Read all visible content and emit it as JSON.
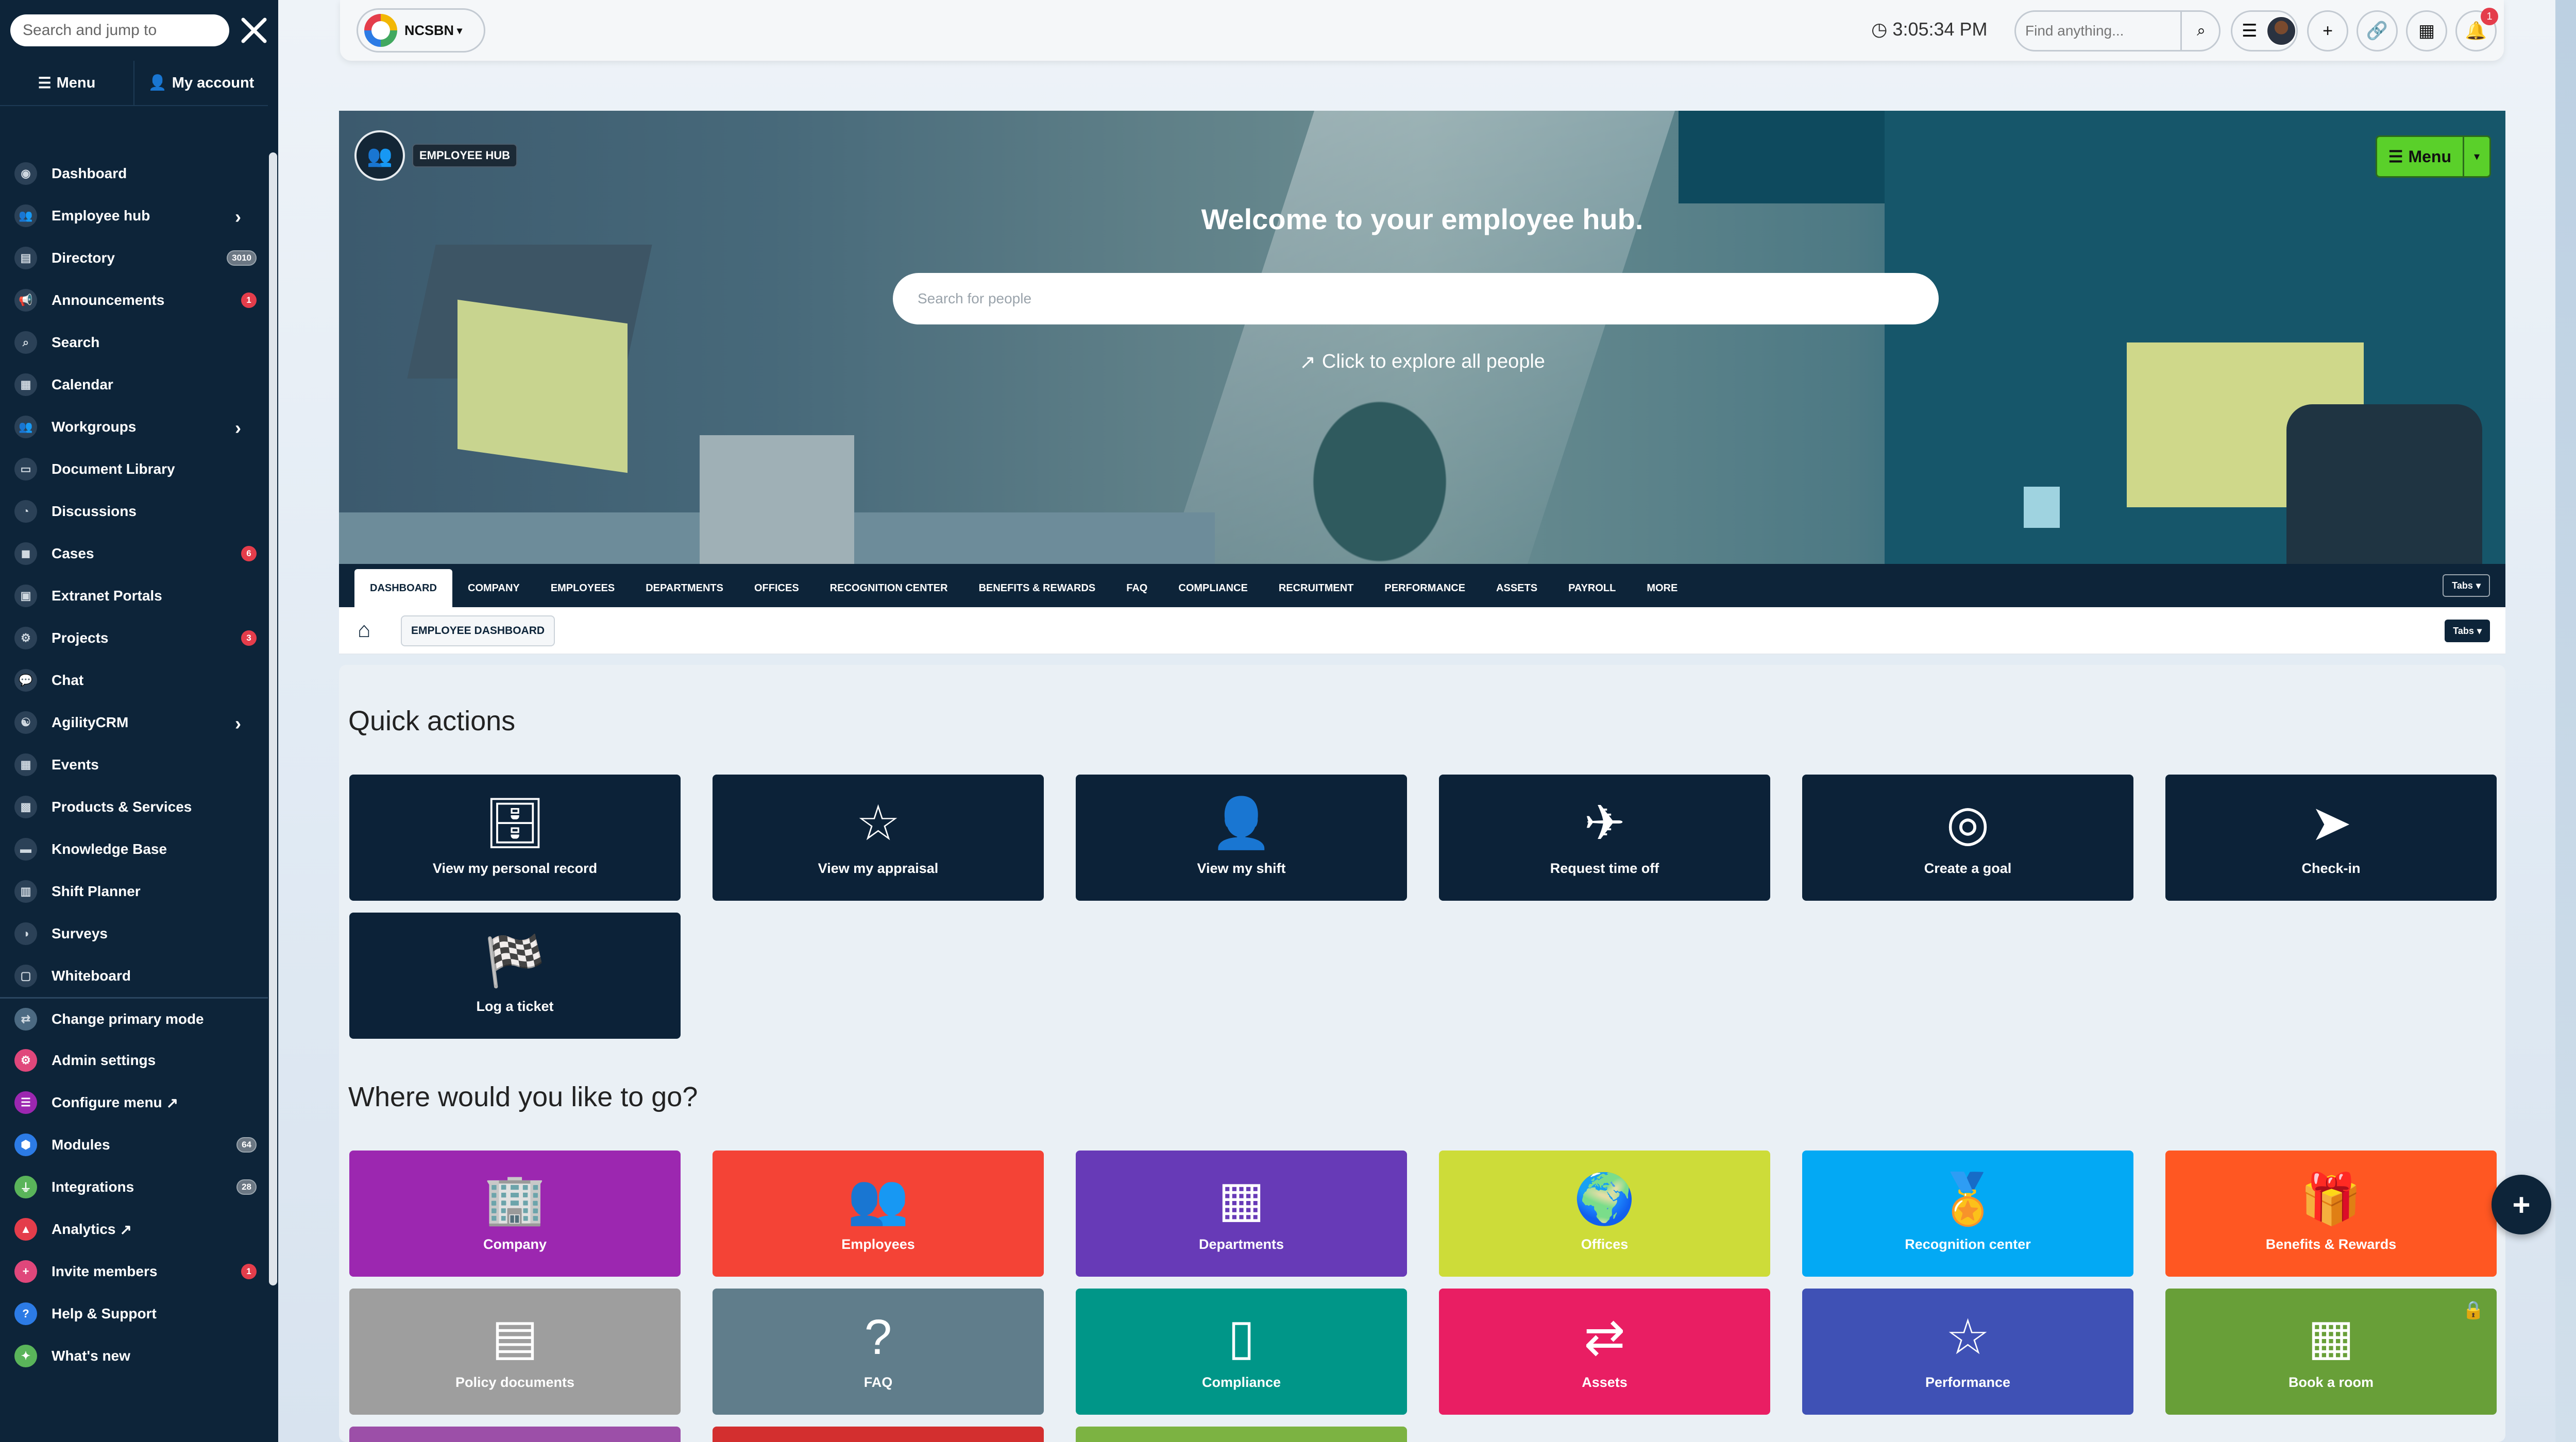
{
  "sidebar": {
    "search_placeholder": "Search and jump to",
    "tabs": {
      "menu": "Menu",
      "account": "My account"
    },
    "items": [
      {
        "label": "Dashboard",
        "icon": "dashboard-icon"
      },
      {
        "label": "Employee hub",
        "icon": "users-icon",
        "chevron": true
      },
      {
        "label": "Directory",
        "icon": "directory-icon",
        "badge": "3010"
      },
      {
        "label": "Announcements",
        "icon": "megaphone-icon",
        "badge": "1"
      },
      {
        "label": "Search",
        "icon": "search-icon"
      },
      {
        "label": "Calendar",
        "icon": "calendar-icon"
      },
      {
        "label": "Workgroups",
        "icon": "workgroups-icon",
        "chevron": true
      },
      {
        "label": "Document Library",
        "icon": "folder-icon"
      },
      {
        "label": "Discussions",
        "icon": "discussion-icon"
      },
      {
        "label": "Cases",
        "icon": "cases-icon",
        "badge": "6"
      },
      {
        "label": "Extranet Portals",
        "icon": "portal-icon"
      },
      {
        "label": "Projects",
        "icon": "projects-icon",
        "badge": "3"
      },
      {
        "label": "Chat",
        "icon": "chat-icon"
      },
      {
        "label": "AgilityCRM",
        "icon": "crm-icon",
        "chevron": true
      },
      {
        "label": "Events",
        "icon": "events-icon"
      },
      {
        "label": "Products & Services",
        "icon": "products-icon"
      },
      {
        "label": "Knowledge Base",
        "icon": "book-icon"
      },
      {
        "label": "Shift Planner",
        "icon": "shift-icon"
      },
      {
        "label": "Surveys",
        "icon": "survey-icon"
      },
      {
        "label": "Whiteboard",
        "icon": "whiteboard-icon"
      },
      {
        "label": "Change primary mode",
        "icon": "swap-icon"
      },
      {
        "label": "Admin settings",
        "icon": "cogs-icon"
      },
      {
        "label": "Configure menu",
        "icon": "list-icon"
      },
      {
        "label": "Modules",
        "icon": "modules-icon",
        "badge": "64"
      },
      {
        "label": "Integrations",
        "icon": "plug-icon",
        "badge": "28"
      },
      {
        "label": "Analytics",
        "icon": "analytics-icon"
      },
      {
        "label": "Invite members",
        "icon": "user-plus-icon",
        "badge": "1"
      },
      {
        "label": "Help & Support",
        "icon": "help-icon"
      },
      {
        "label": "What's new",
        "icon": "gift-icon"
      }
    ]
  },
  "topbar": {
    "org": "NCSBN",
    "time": "3:05:34 PM",
    "find_placeholder": "Find anything...",
    "notif_count": "1"
  },
  "hero": {
    "badge": "EMPLOYEE HUB",
    "menu": "Menu",
    "welcome": "Welcome to your employee hub.",
    "search_placeholder": "Search for people",
    "explore": "Click to explore all people"
  },
  "tabs": {
    "items": [
      "DASHBOARD",
      "COMPANY",
      "EMPLOYEES",
      "DEPARTMENTS",
      "OFFICES",
      "RECOGNITION CENTER",
      "BENEFITS & REWARDS",
      "FAQ",
      "COMPLIANCE",
      "RECRUITMENT",
      "PERFORMANCE",
      "ASSETS",
      "PAYROLL",
      "MORE"
    ],
    "toggle": "Tabs"
  },
  "breadcrumb": {
    "current": "EMPLOYEE DASHBOARD",
    "toggle": "Tabs"
  },
  "quick_actions": {
    "title": "Quick actions",
    "items": [
      {
        "label": "View my personal record",
        "icon": "database-icon"
      },
      {
        "label": "View my appraisal",
        "icon": "star-icon"
      },
      {
        "label": "View my shift",
        "icon": "user-clock-icon"
      },
      {
        "label": "Request time off",
        "icon": "plane-icon"
      },
      {
        "label": "Create a goal",
        "icon": "target-icon"
      },
      {
        "label": "Check-in",
        "icon": "location-arrow-icon"
      },
      {
        "label": "Log a ticket",
        "icon": "checkered-flag-icon"
      }
    ]
  },
  "destinations": {
    "title": "Where would you like to go?",
    "items": [
      {
        "label": "Company",
        "icon": "building-icon",
        "color": "#9c27b0"
      },
      {
        "label": "Employees",
        "icon": "users-icon",
        "color": "#f44336"
      },
      {
        "label": "Departments",
        "icon": "office-building-icon",
        "color": "#673ab7"
      },
      {
        "label": "Offices",
        "icon": "globe-icon",
        "color": "#cddc39"
      },
      {
        "label": "Recognition center",
        "icon": "medal-icon",
        "color": "#03a9f4"
      },
      {
        "label": "Benefits & Rewards",
        "icon": "gift-icon",
        "color": "#ff5722"
      },
      {
        "label": "Policy documents",
        "icon": "book-icon",
        "color": "#9e9e9e"
      },
      {
        "label": "FAQ",
        "icon": "question-icon",
        "color": "#607d8b"
      },
      {
        "label": "Compliance",
        "icon": "file-icon",
        "color": "#009688"
      },
      {
        "label": "Assets",
        "icon": "hands-icon",
        "color": "#e91e63"
      },
      {
        "label": "Performance",
        "icon": "star-icon",
        "color": "#3f51b5"
      },
      {
        "label": "Book a room",
        "icon": "calendar-plus-icon",
        "color": "#689f38",
        "locked": true
      }
    ]
  }
}
